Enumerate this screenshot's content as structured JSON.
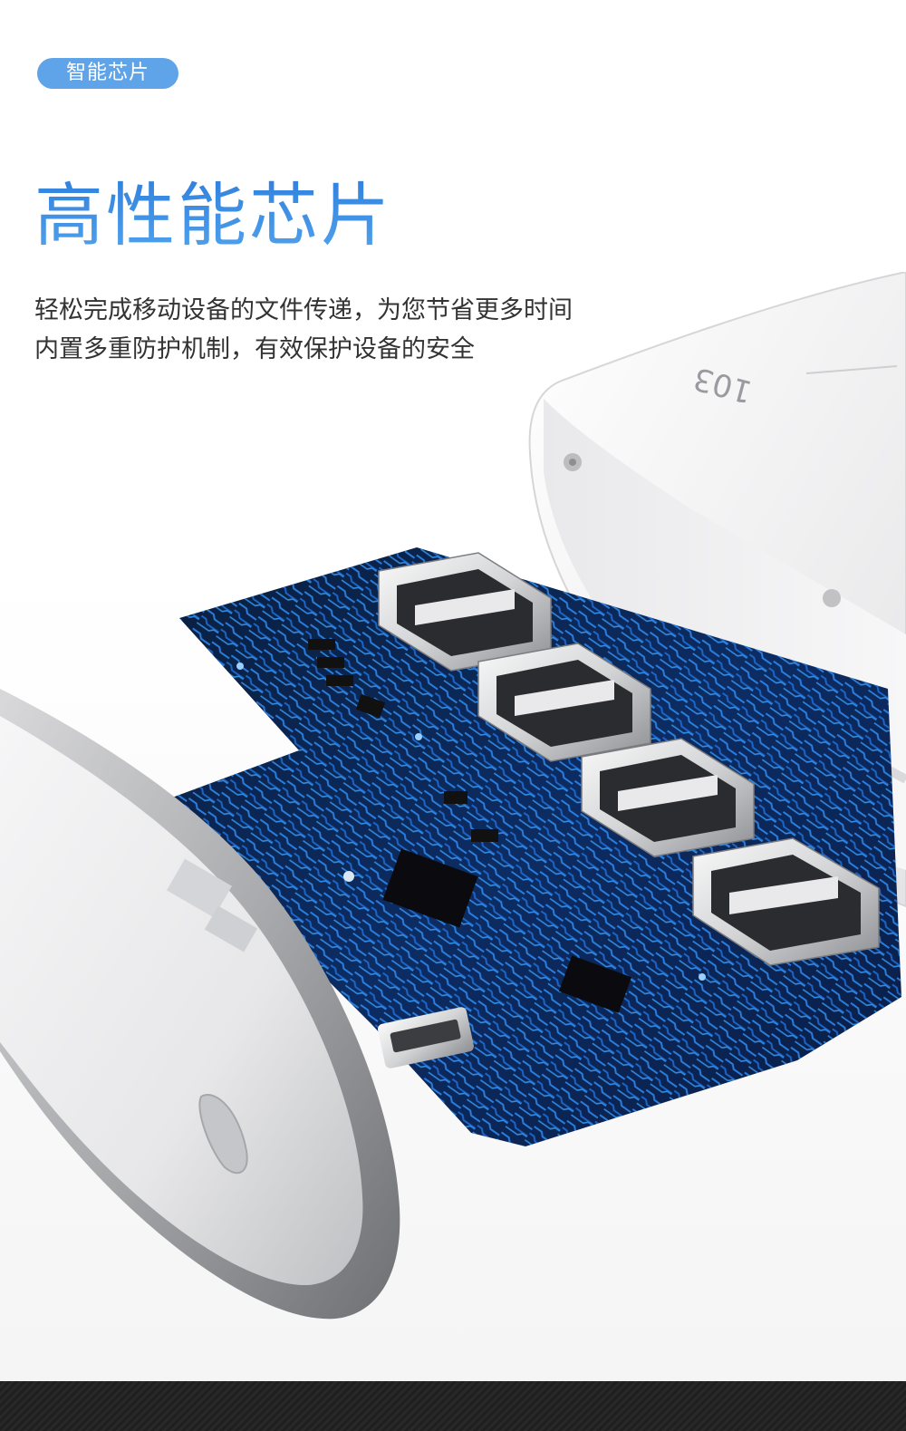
{
  "tag": {
    "label": "智能芯片"
  },
  "headline": "高性能芯片",
  "description": {
    "line1": "轻松完成移动设备的文件传递，为您节省更多时间",
    "line2": "内置多重防护机制，有效保护设备的安全"
  },
  "product": {
    "model_marking": "103",
    "usb_port_count": 4,
    "board_color": "#1b5fc4",
    "case_color": "#f2f2f2"
  },
  "colors": {
    "accent": "#3a8ee2",
    "pill": "#5fa3e9",
    "footer": "#222222"
  }
}
